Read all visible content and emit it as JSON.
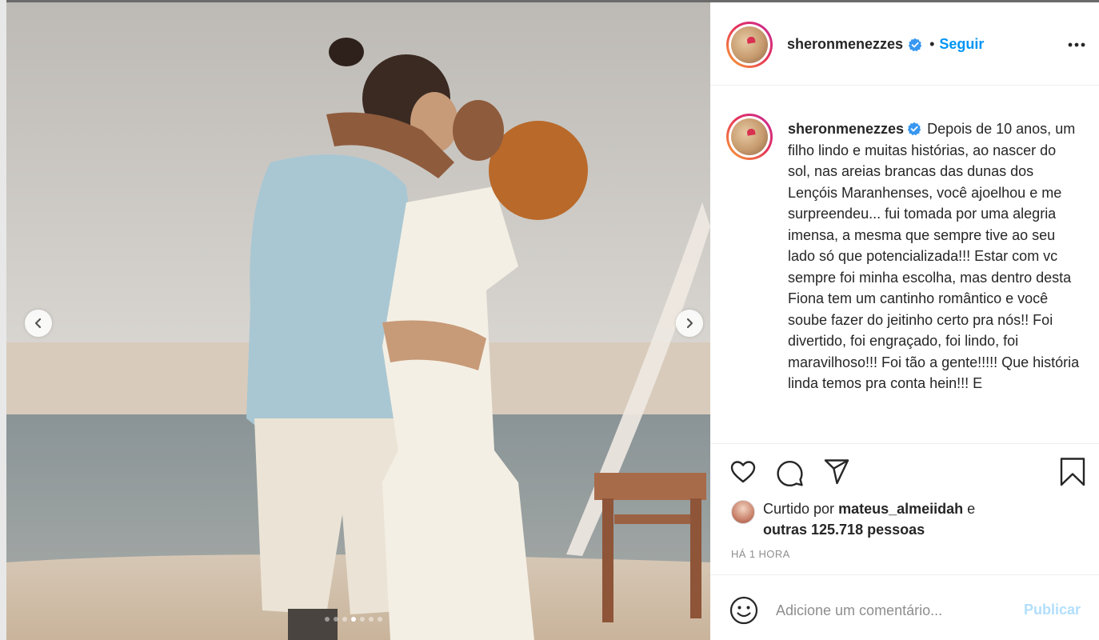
{
  "post": {
    "username": "sheronmenezzes",
    "follow_separator": "•",
    "follow_label": "Seguir",
    "caption_username": "sheronmenezzes",
    "caption": "Depois de 10 anos, um filho lindo e muitas histórias, ao nascer do sol, nas areias brancas das dunas dos Lençóis Maranhenses, você ajoelhou e me surpreendeu... fui tomada por uma alegria imensa, a mesma que sempre tive ao seu lado só que potencializada!!! Estar com vc sempre foi minha escolha, mas dentro desta Fiona tem um cantinho romântico e você soube fazer do jeitinho certo pra nós!! Foi divertido, foi engraçado, foi lindo, foi maravilhoso!!! Foi tão a gente!!!!! Que história linda temos pra conta hein!!! E",
    "likes_prefix": "Curtido por",
    "likes_user": "mateus_almeiidah",
    "likes_and": "e",
    "likes_others": "outras 125.718 pessoas",
    "timestamp": "HÁ 1 HORA"
  },
  "media": {
    "slide_count": 7,
    "active_slide": 4
  },
  "comment": {
    "placeholder": "Adicione um comentário...",
    "publish_label": "Publicar"
  },
  "colors": {
    "accent": "#0095f6",
    "verified": "#3897f0",
    "publish_disabled": "#b2dffc",
    "muted": "#8e8e8e",
    "text": "#262626"
  },
  "icons": [
    "verified-badge-icon",
    "more-options-icon",
    "heart-icon",
    "comment-icon",
    "share-icon",
    "bookmark-icon",
    "emoji-icon",
    "chevron-left-icon",
    "chevron-right-icon"
  ]
}
